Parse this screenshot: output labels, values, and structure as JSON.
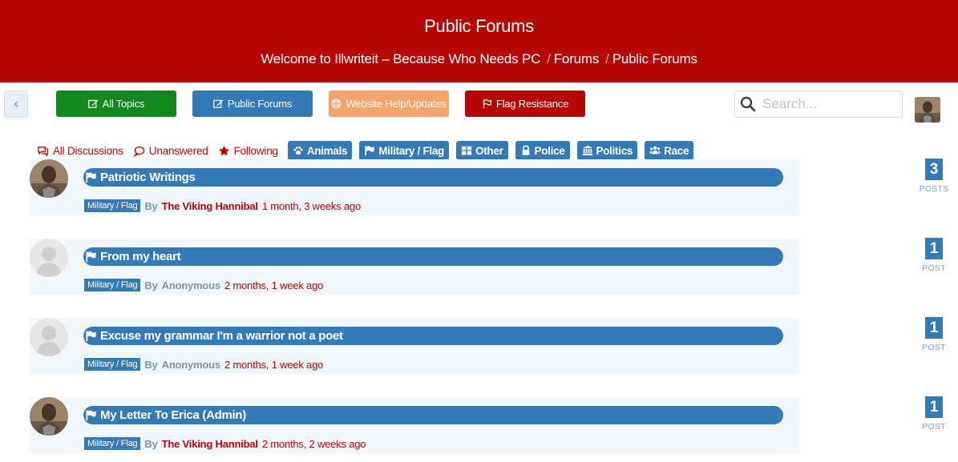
{
  "header": {
    "title": "Public Forums",
    "breadcrumbs": [
      "Welcome to Illwriteit – Because Who Needs PC",
      "Forums",
      "Public Forums"
    ],
    "background": "#b60707"
  },
  "toolbar": {
    "back_label": "‹",
    "buttons": [
      {
        "label": "All Topics",
        "icon": "edit-icon",
        "color": "#12881f"
      },
      {
        "label": "Public Forums",
        "icon": "edit-icon",
        "color": "#337ab7"
      },
      {
        "label": "Website Help/Updates",
        "icon": "life-ring-icon",
        "color": "#f2a46a"
      },
      {
        "label": "Flag Resistance",
        "icon": "flag-outline-icon",
        "color": "#b60707"
      }
    ],
    "search_placeholder": "Search..."
  },
  "filters": {
    "links": [
      {
        "label": "All Discussions",
        "icon": "comments-icon"
      },
      {
        "label": "Unanswered",
        "icon": "comment-icon"
      },
      {
        "label": "Following",
        "icon": "star-icon"
      }
    ],
    "categories": [
      {
        "label": "Animals",
        "icon": "paw-icon"
      },
      {
        "label": "Military / Flag",
        "icon": "flag-icon"
      },
      {
        "label": "Other",
        "icon": "grid-icon"
      },
      {
        "label": "Police",
        "icon": "lock-icon"
      },
      {
        "label": "Politics",
        "icon": "institution-icon"
      },
      {
        "label": "Race",
        "icon": "users-icon"
      }
    ]
  },
  "topics": [
    {
      "title": "Patriotic Writings",
      "category": "Military / Flag",
      "by": "By",
      "author": "The Viking Hannibal",
      "time": "1 month, 3 weeks ago",
      "count": "3",
      "count_label": "POSTS",
      "avatar": "photo"
    },
    {
      "title": "From my heart",
      "category": "Military / Flag",
      "by": "By",
      "author": "Anonymous",
      "time": "2 months, 1 week ago",
      "count": "1",
      "count_label": "POST",
      "avatar": "default"
    },
    {
      "title": "Excuse my grammar I'm a warrior not a poet",
      "category": "Military / Flag",
      "by": "By",
      "author": "Anonymous",
      "time": "2 months, 1 week ago",
      "count": "1",
      "count_label": "POST",
      "avatar": "default"
    },
    {
      "title": "My Letter To Erica (Admin)",
      "category": "Military / Flag",
      "by": "By",
      "author": "The Viking Hannibal",
      "time": "2 months, 2 weeks ago",
      "count": "1",
      "count_label": "POST",
      "avatar": "photo"
    }
  ]
}
